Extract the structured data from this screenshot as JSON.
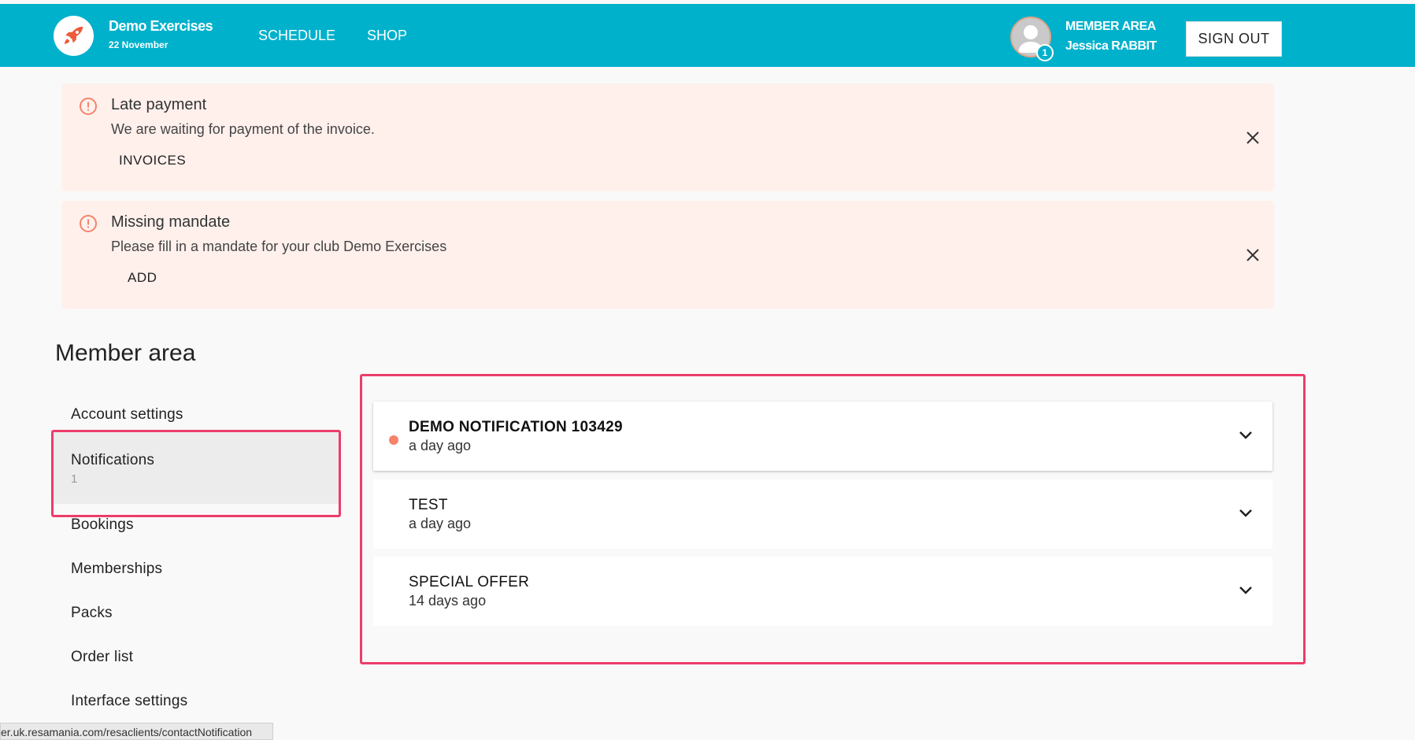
{
  "header": {
    "club_name": "Demo Exercises",
    "club_date": "22 November",
    "nav": [
      "SCHEDULE",
      "SHOP"
    ],
    "member_area_label": "MEMBER AREA",
    "member_name": "Jessica RABBIT",
    "avatar_badge": "1",
    "sign_out": "SIGN OUT"
  },
  "alerts": [
    {
      "title": "Late payment",
      "message": "We are waiting for payment of the invoice.",
      "action": "INVOICES"
    },
    {
      "title": "Missing mandate",
      "message": "Please fill in a mandate for your club Demo Exercises",
      "action": "ADD"
    }
  ],
  "section_title": "Member area",
  "sidebar": {
    "items": [
      {
        "label": "Account settings"
      },
      {
        "label": "Notifications",
        "count": "1"
      },
      {
        "label": "Bookings"
      },
      {
        "label": "Memberships"
      },
      {
        "label": "Packs"
      },
      {
        "label": "Order list"
      },
      {
        "label": "Interface settings"
      }
    ]
  },
  "notifications": [
    {
      "title": "DEMO NOTIFICATION 103429",
      "time": "a day ago"
    },
    {
      "title": "TEST",
      "time": "a day ago"
    },
    {
      "title": "SPECIAL OFFER",
      "time": "14 days ago"
    }
  ],
  "status_url": "er.uk.resamania.com/resaclients/contactNotification",
  "colors": {
    "header": "#00b1cc",
    "alert_bg": "#fff0ec",
    "alert_icon": "#f5836b",
    "highlight": "#ec3d6a",
    "unread_dot": "#f5836b"
  }
}
